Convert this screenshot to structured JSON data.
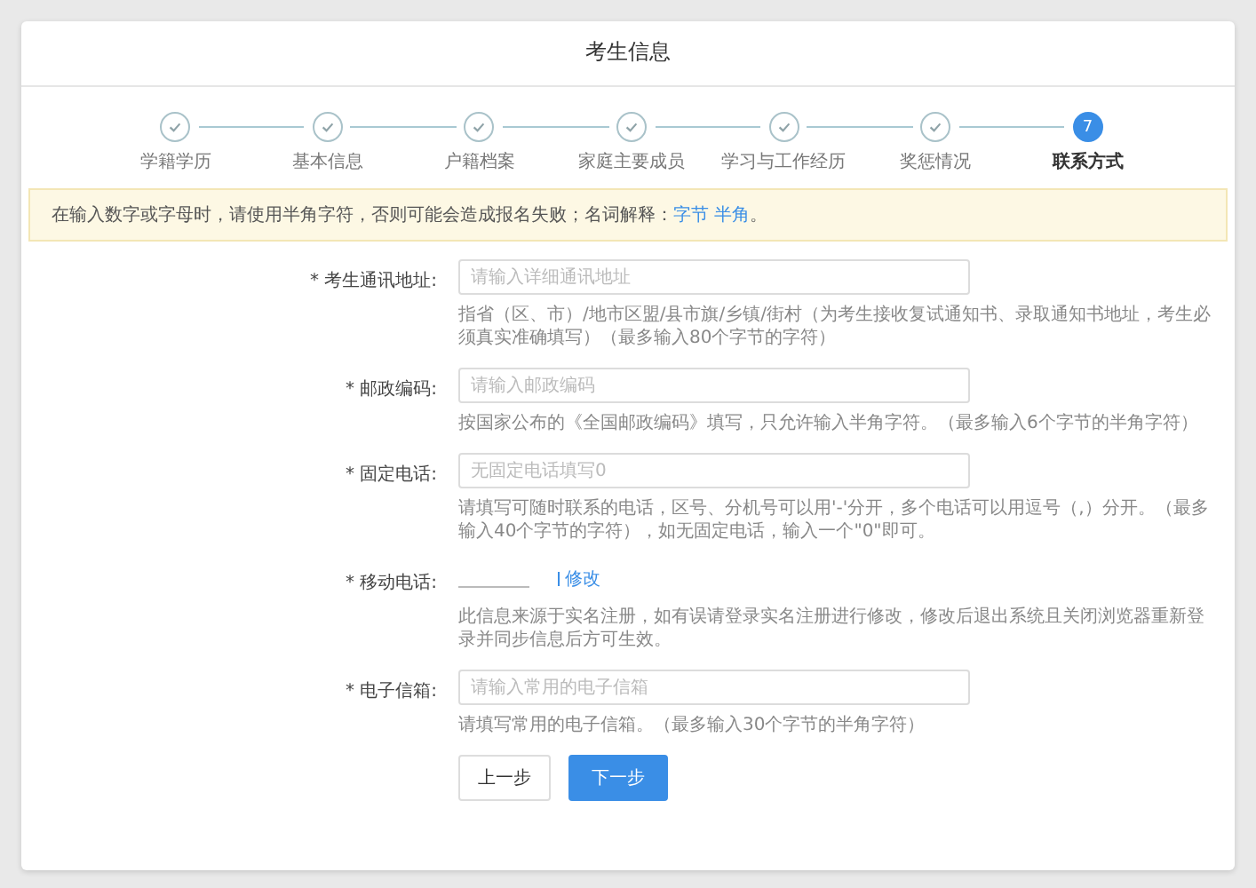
{
  "window": {
    "title": "考生信息"
  },
  "steps": [
    {
      "label": "学籍学历",
      "done": true,
      "selected": false
    },
    {
      "label": "基本信息",
      "done": true,
      "selected": false
    },
    {
      "label": "户籍档案",
      "done": true,
      "selected": false
    },
    {
      "label": "家庭主要成员",
      "done": true,
      "selected": false
    },
    {
      "label": "学习与工作经历",
      "done": true,
      "selected": false
    },
    {
      "label": "奖惩情况",
      "done": true,
      "selected": false
    },
    {
      "label": "联系方式",
      "number": "7",
      "done": false,
      "selected": true
    }
  ],
  "notice": {
    "text": "在输入数字或字母时，请使用半角字符，否则可能会造成报名失败；名词解释：",
    "links": [
      "字节",
      "半角"
    ],
    "end": "。"
  },
  "fields": [
    {
      "kind": "input",
      "label": "* 考生通讯地址:",
      "placeholder": "请输入详细通讯地址",
      "hint": "指省（区、市）/地市区盟/县市旗/乡镇/街村（为考生接收复试通知书、录取通知书地址，考生必须真实准确填写）（最多输入80个字节的字符）"
    },
    {
      "kind": "input",
      "label": "* 邮政编码:",
      "placeholder": "请输入邮政编码",
      "hint": "按国家公布的《全国邮政编码》填写，只允许输入半角字符。（最多输入6个字节的半角字符）"
    },
    {
      "kind": "input",
      "label": "* 固定电话:",
      "placeholder": "无固定电话填写0",
      "hint": "请填写可随时联系的电话，区号、分机号可以用'-'分开，多个电话可以用逗号（,）分开。（最多输入40个字节的字符），如无固定电话，输入一个\"0\"即可。"
    },
    {
      "kind": "readonly",
      "label": "* 移动电话:",
      "link": "修改",
      "hint": "此信息来源于实名注册，如有误请登录实名注册进行修改，修改后退出系统且关闭浏览器重新登录并同步信息后方可生效。"
    },
    {
      "kind": "input",
      "label": "* 电子信箱:",
      "placeholder": "请输入常用的电子信箱",
      "hint": "请填写常用的电子信箱。（最多输入30个字节的半角字符）"
    }
  ],
  "buttons": [
    {
      "label": "上一步",
      "kind": "default"
    },
    {
      "label": "下一步",
      "kind": "primary"
    }
  ]
}
